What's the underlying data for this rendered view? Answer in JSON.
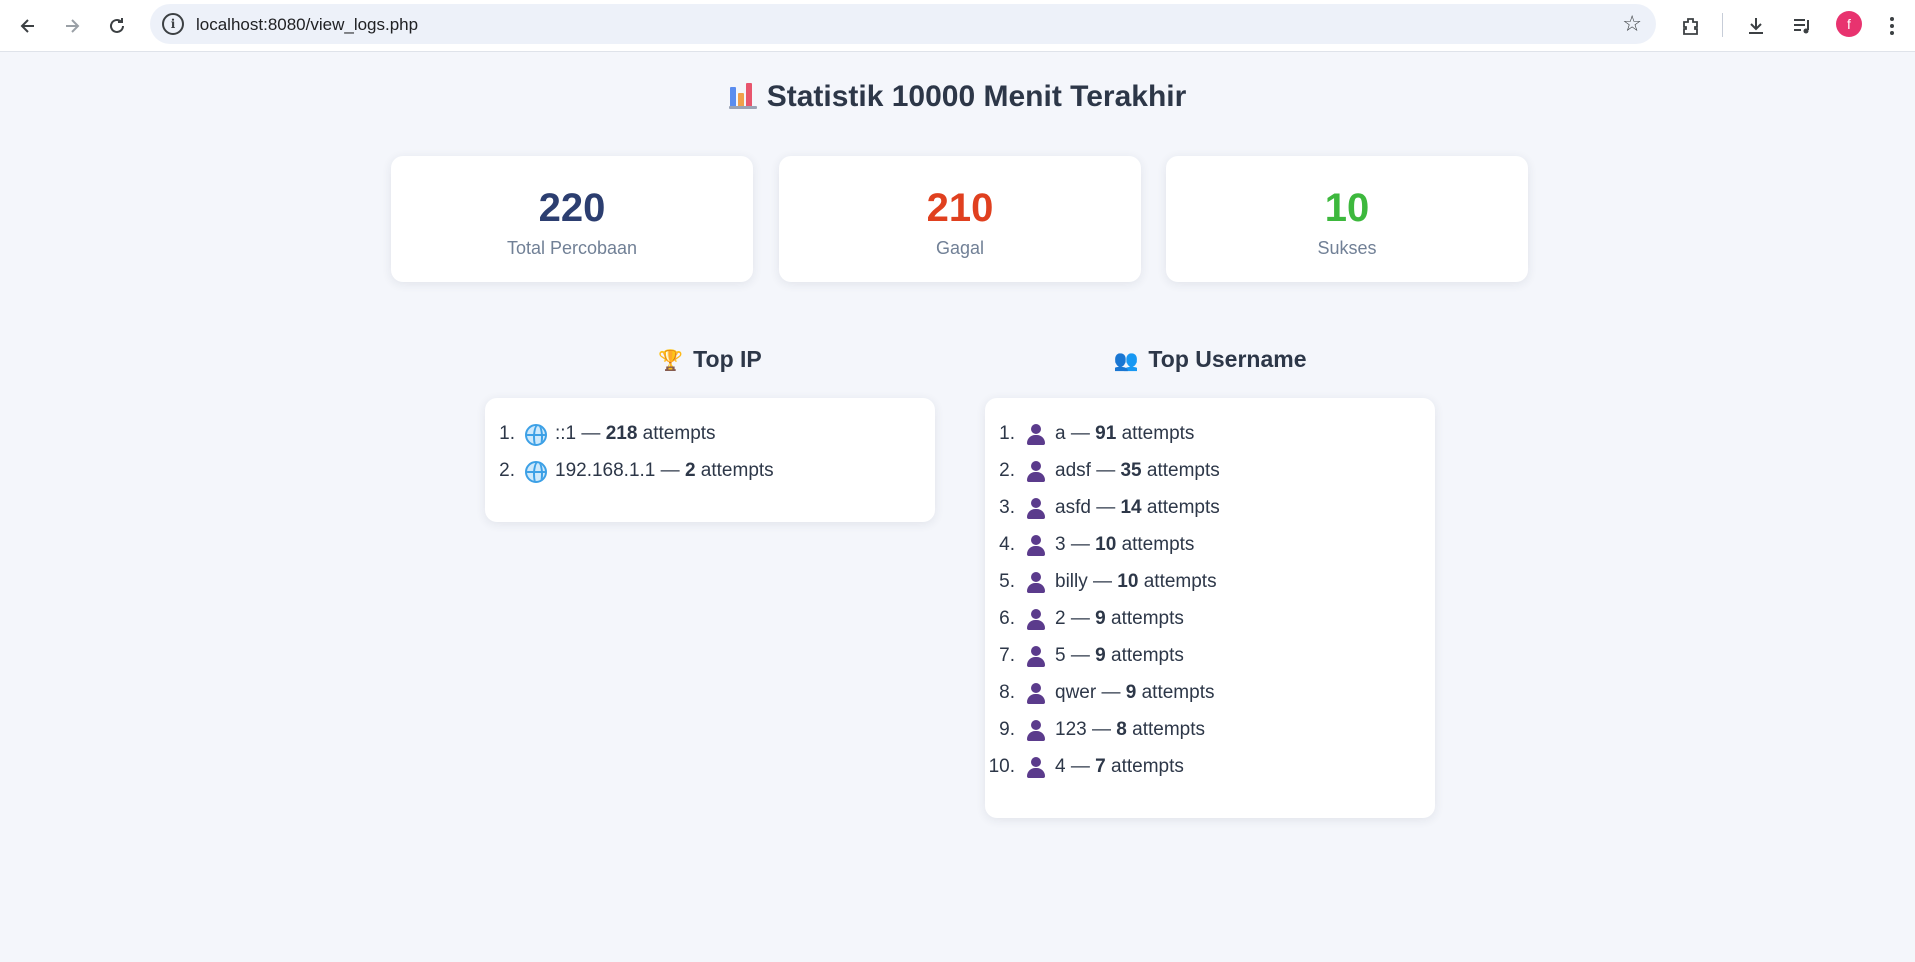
{
  "browser": {
    "url": "localhost:8080/view_logs.php",
    "avatar_letter": "f"
  },
  "page": {
    "title": "Statistik 10000 Menit Terakhir",
    "title_icon": "bar-chart-icon"
  },
  "stats": [
    {
      "value": "220",
      "label": "Total Percobaan",
      "color": "#2c3e70"
    },
    {
      "value": "210",
      "label": "Gagal",
      "color": "#e0401f"
    },
    {
      "value": "10",
      "label": "Sukses",
      "color": "#3db83d"
    }
  ],
  "top_ip": {
    "title": "Top IP",
    "icon": "trophy-icon",
    "suffix": "attempts",
    "items": [
      {
        "num": "1.",
        "name": "::1",
        "count": "218"
      },
      {
        "num": "2.",
        "name": "192.168.1.1",
        "count": "2"
      }
    ]
  },
  "top_username": {
    "title": "Top Username",
    "icon": "users-icon",
    "suffix": "attempts",
    "items": [
      {
        "num": "1.",
        "name": "a",
        "count": "91"
      },
      {
        "num": "2.",
        "name": "adsf",
        "count": "35"
      },
      {
        "num": "3.",
        "name": "asfd",
        "count": "14"
      },
      {
        "num": "4.",
        "name": "3",
        "count": "10"
      },
      {
        "num": "5.",
        "name": "billy",
        "count": "10"
      },
      {
        "num": "6.",
        "name": "2",
        "count": "9"
      },
      {
        "num": "7.",
        "name": "5",
        "count": "9"
      },
      {
        "num": "8.",
        "name": "qwer",
        "count": "9"
      },
      {
        "num": "9.",
        "name": "123",
        "count": "8"
      },
      {
        "num": "10.",
        "name": "4",
        "count": "7"
      }
    ]
  }
}
